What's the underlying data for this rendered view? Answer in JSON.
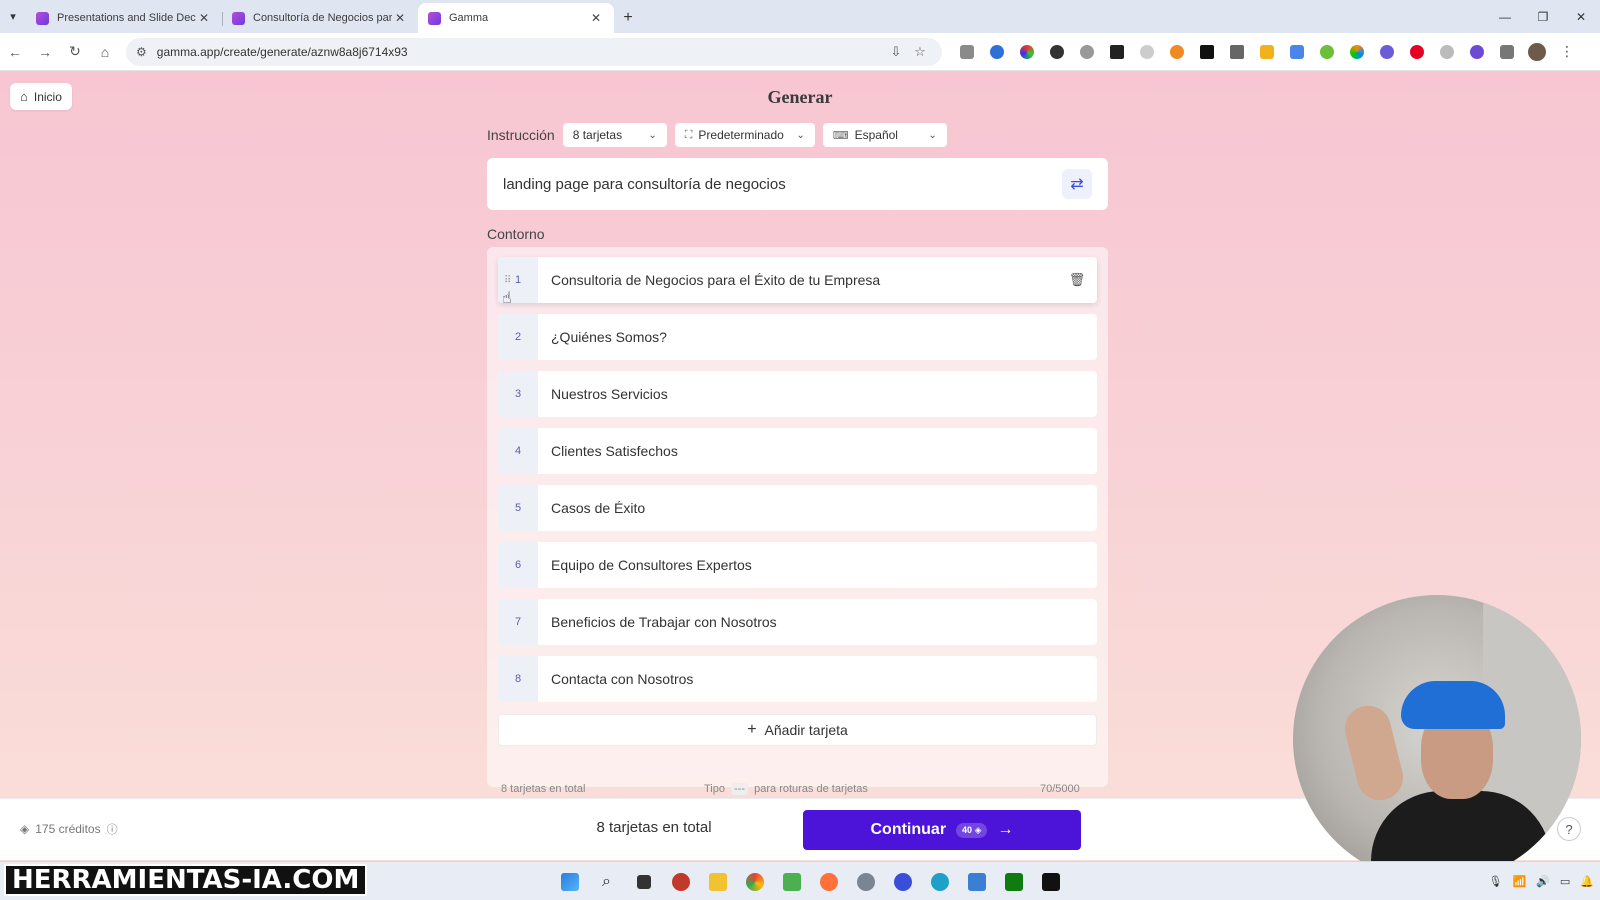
{
  "browser": {
    "tabs": [
      {
        "title": "Presentations and Slide Decks",
        "active": false
      },
      {
        "title": "Consultoría de Negocios para el",
        "active": false
      },
      {
        "title": "Gamma",
        "active": true
      }
    ],
    "url": "gamma.app/create/generate/aznw8a8j6714x93"
  },
  "page": {
    "home_label": "Inicio",
    "title": "Generar",
    "instruction_label": "Instrucción",
    "cards_select": "8 tarjetas",
    "theme_select": "Predeterminado",
    "language_select": "Español",
    "prompt": "landing page para consultoría de negocios",
    "outline_label": "Contorno",
    "cards": [
      {
        "num": "1",
        "title": "Consultoria de Negocios para el Éxito de tu Empresa"
      },
      {
        "num": "2",
        "title": "¿Quiénes Somos?"
      },
      {
        "num": "3",
        "title": "Nuestros Servicios"
      },
      {
        "num": "4",
        "title": "Clientes Satisfechos"
      },
      {
        "num": "5",
        "title": "Casos de Éxito"
      },
      {
        "num": "6",
        "title": "Equipo de Consultores Expertos"
      },
      {
        "num": "7",
        "title": "Beneficios de Trabajar con Nosotros"
      },
      {
        "num": "8",
        "title": "Contacta con Nosotros"
      }
    ],
    "add_card": "Añadir tarjeta",
    "meta_total": "8 tarjetas en total",
    "meta_tip_prefix": "Tipo",
    "meta_tip_key": "---",
    "meta_tip_suffix": "para roturas de tarjetas",
    "char_count": "70/5000"
  },
  "action_bar": {
    "credits": "175 créditos",
    "total": "8 tarjetas en total",
    "continue_label": "Continuar",
    "continue_cost": "40",
    "help": "?"
  },
  "watermark": "HERRAMIENTAS-IA.COM",
  "colors": {
    "accent": "#4b14d8",
    "background_pink": "#f7c6d2"
  }
}
